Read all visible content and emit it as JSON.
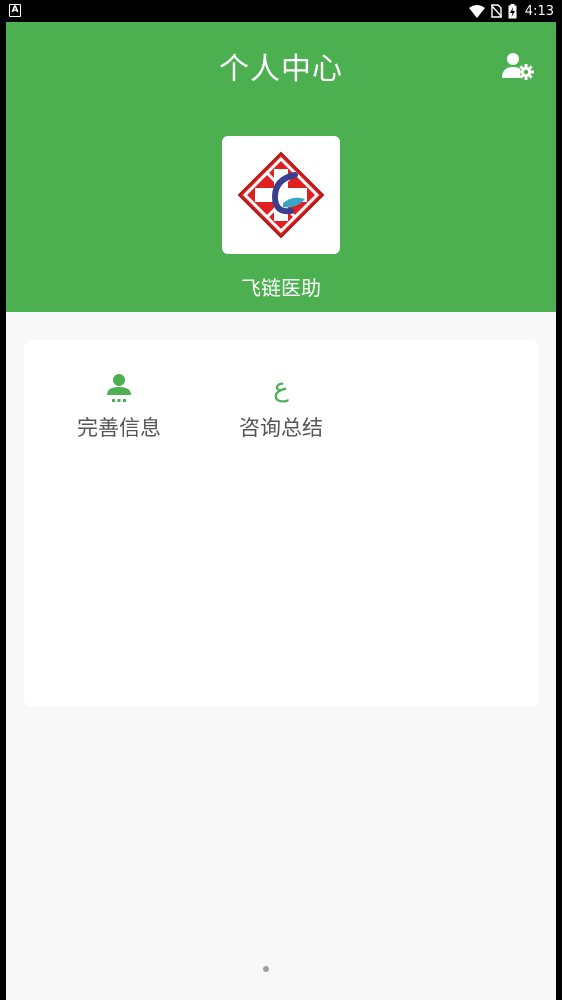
{
  "status_bar": {
    "left_badge": "A",
    "time": "4:13",
    "icons": [
      "wifi-icon",
      "no-sim-icon",
      "battery-charging-icon"
    ]
  },
  "header": {
    "title": "个人中心",
    "settings_icon": "user-settings-icon",
    "app_name": "飞链医助",
    "background_color": "#4caf50"
  },
  "menu": {
    "items": [
      {
        "label": "完善信息",
        "icon": "user-profile-icon"
      },
      {
        "label": "咨询总结",
        "icon": "epsilon-icon",
        "glyph": "ع"
      }
    ]
  },
  "pager": {
    "active_index": 0
  },
  "colors": {
    "accent": "#4caf50",
    "page_background": "#f8f8f8",
    "card": "#ffffff"
  }
}
